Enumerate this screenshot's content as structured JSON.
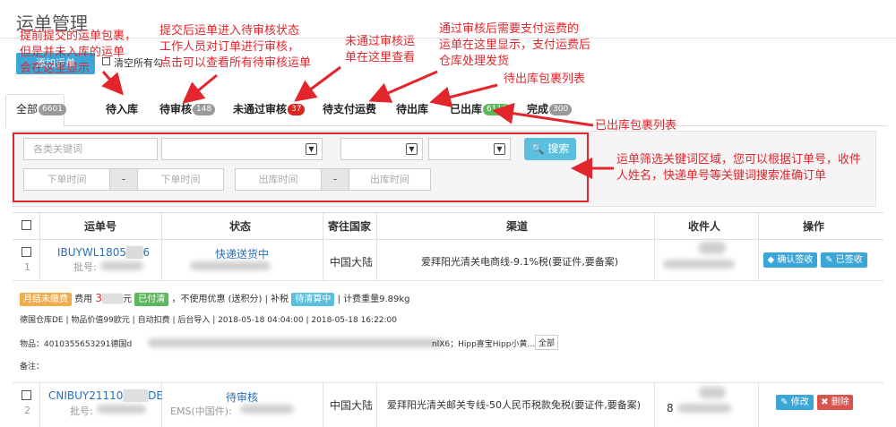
{
  "page": {
    "title": "运单管理",
    "top_button": "添加运单",
    "clear_label": "清空所有勾选"
  },
  "tabs": [
    {
      "label": "全部",
      "count": "6601"
    },
    {
      "label": "待入库",
      "count": ""
    },
    {
      "label": "待审核",
      "count": "148"
    },
    {
      "label": "未通过审核",
      "count": "37"
    },
    {
      "label": "待支付运费",
      "count": ""
    },
    {
      "label": "待出库",
      "count": ""
    },
    {
      "label": "已出库",
      "count": "6116"
    },
    {
      "label": "完成",
      "count": "300"
    }
  ],
  "filters": {
    "keyword_placeholder": "各类关键词",
    "order_time_start": "下单时间",
    "order_time_end": "下单时间",
    "out_time_start": "出库时间",
    "out_time_end": "出库时间",
    "range_sep": "-",
    "search_label": "搜索"
  },
  "table": {
    "headers": [
      "运单号",
      "状态",
      "寄往国家",
      "渠道",
      "收件人",
      "操作"
    ],
    "rows": [
      {
        "index": "1",
        "order_no": "IBUYWL1805",
        "order_no_tail": "6",
        "batch": "批号:",
        "status": "快递送货中",
        "country": "中国大陆",
        "channel": "爱拜阳光清关电商线-9.1%税(要证件,要备案)",
        "actions": [
          "确认签收",
          "已签收"
        ],
        "detail": {
          "tag_unpaid": "月结未缴费",
          "fee_label": "费用",
          "fee_value": "3",
          "fee_unit": "元",
          "tag_paid": "已付清",
          "discount": "，不使用优惠 (送积分) | 补税",
          "tag_tax": "待清算中",
          "weight": "| 计费重量9.89kg",
          "line2": "德国仓库DE | 物品价值99欧元 | 自动扣费 | 后台导入 | 2018-05-18 04:04:00 | 2018-05-18 16:22:00",
          "goods_label": "物品：",
          "goods_head": "4010355653291德国d",
          "goods_tail": "nlX6；Hipp喜宝Hipp小黄...",
          "goods_all": "全部",
          "remark_label": "备注："
        }
      },
      {
        "index": "2",
        "order_no": "CNIBUY21110",
        "order_no_tail": "DE",
        "batch": "批号:",
        "status": "待审核",
        "status_sub": "EMS(中国件):",
        "country": "中国大陆",
        "channel": "爱拜阳光清关邮关专线-50人民币税款免税(要证件,要备案)",
        "recipient_part": "8",
        "actions": [
          "修改",
          "删除"
        ]
      }
    ]
  },
  "annotations": [
    "提前提交的运单包裹，\n但是并未入库的运单\n会在这里显示",
    "提交后运单进入待审核状态\n工作人员对订单进行审核，\n点击可以查看所有待审核运单",
    "未通过审核运\n单在这里查看",
    "通过审核后需要支付运费的\n运单在这里显示，支付运费后\n仓库处理发货",
    "待出库包裹列表",
    "已出库包裹列表",
    "运单筛选关键词区域，您可以根据订单号，收件\n人姓名，快递单号等关键词搜索准确订单"
  ],
  "colors": {
    "annotation": "#e3262c",
    "link": "#2a70b8",
    "badge_red": "#d9251d",
    "badge_green": "#5cb85c",
    "search_btn": "#5bc0de"
  }
}
